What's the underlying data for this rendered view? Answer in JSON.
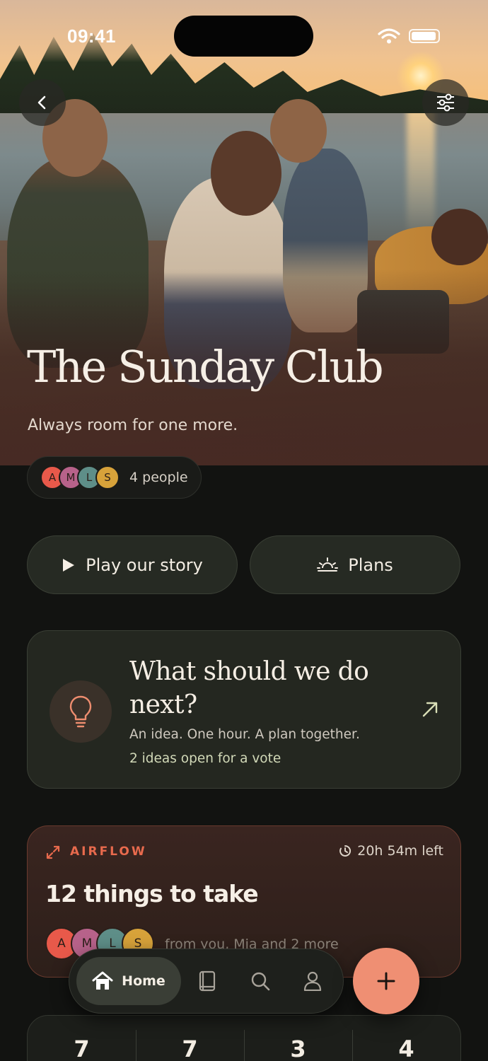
{
  "status_bar": {
    "time": "09:41"
  },
  "hero": {
    "title": "The Sunday Club",
    "subtitle": "Always room for one more."
  },
  "members": {
    "avatars": [
      {
        "initial": "A",
        "color": "#e8594a"
      },
      {
        "initial": "M",
        "color": "#b7628a"
      },
      {
        "initial": "L",
        "color": "#5e8e88"
      },
      {
        "initial": "S",
        "color": "#d7a23a"
      }
    ],
    "count_label": "4 people"
  },
  "actions": {
    "play_label": "Play our story",
    "plans_label": "Plans"
  },
  "idea_card": {
    "title": "What should we do next?",
    "subtitle": "An idea. One hour. A plan together.",
    "votes": "2 ideas open for a vote"
  },
  "airflow_card": {
    "tag": "AIRFLOW",
    "time_left": "20h 54m left",
    "title": "12 things to take",
    "from": "from you, Mia and 2 more",
    "avatars": [
      "A",
      "M",
      "L",
      "S"
    ]
  },
  "stats": [
    "7",
    "7",
    "3",
    "4"
  ],
  "tabbar": {
    "home_label": "Home",
    "items": [
      "home-icon",
      "book-icon",
      "search-icon",
      "profile-icon"
    ]
  },
  "colors": {
    "accent": "#ef8f73",
    "airflow": "#e86a4d",
    "background": "#121311"
  }
}
